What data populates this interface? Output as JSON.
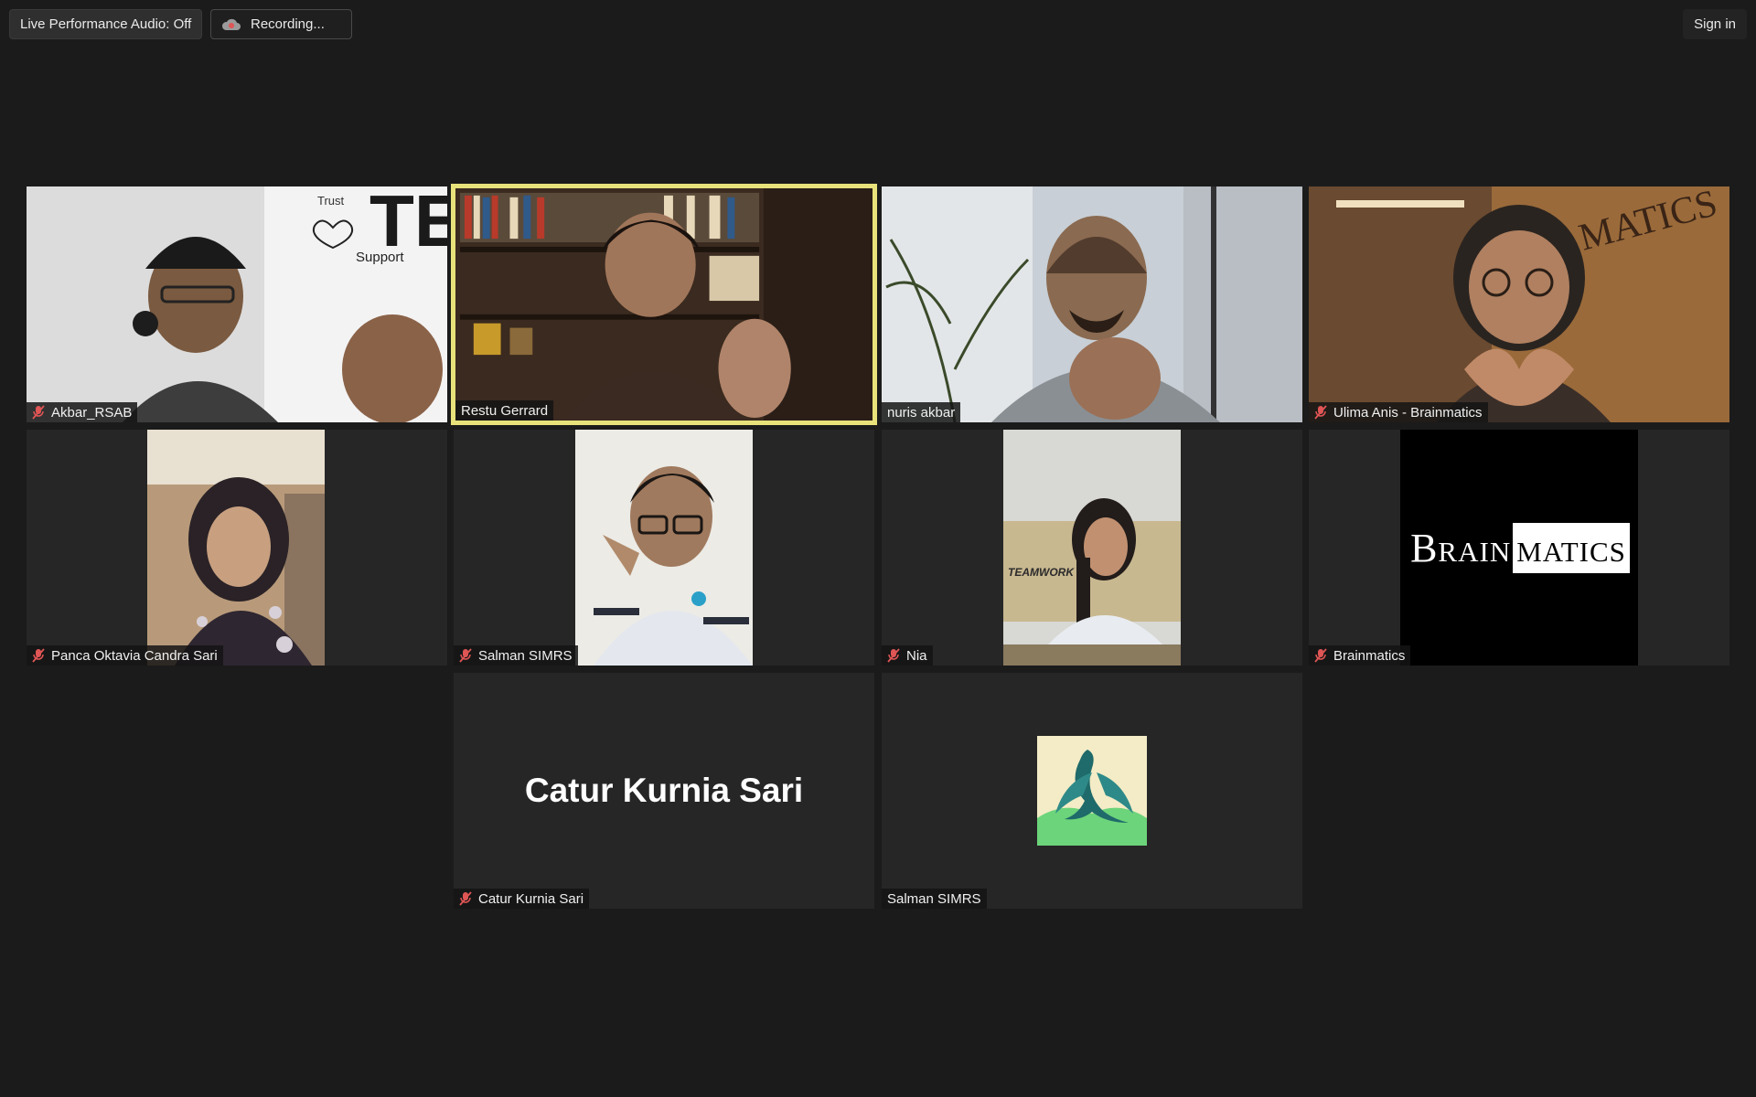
{
  "toolbar": {
    "live_audio_label": "Live Performance Audio: Off",
    "recording_label": "Recording...",
    "sign_in_label": "Sign in"
  },
  "colors": {
    "background": "#1b1b1b",
    "tile_background": "#262626",
    "active_speaker_border": "#e8e27a",
    "muted_icon": "#e05555"
  },
  "participants": [
    {
      "name": "Akbar_RSAB",
      "muted": true,
      "video": "camera"
    },
    {
      "name": "Restu Gerrard",
      "muted": false,
      "video": "camera",
      "active_speaker": true
    },
    {
      "name": "nuris akbar",
      "muted": false,
      "video": "camera"
    },
    {
      "name": "Ulima Anis - Brainmatics",
      "muted": true,
      "video": "camera"
    },
    {
      "name": "Panca Oktavia Candra Sari",
      "muted": true,
      "video": "camera"
    },
    {
      "name": "Salman SIMRS",
      "muted": true,
      "video": "camera"
    },
    {
      "name": "Nia",
      "muted": true,
      "video": "camera"
    },
    {
      "name": "Brainmatics",
      "muted": true,
      "video": "logo"
    },
    {
      "name": "Catur Kurnia Sari",
      "muted": true,
      "video": "off",
      "display_name": "Catur Kurnia Sari"
    },
    {
      "name": "Salman SIMRS",
      "muted": false,
      "video": "avatar"
    }
  ],
  "brainmatics_logo": {
    "part1": "Brain",
    "part2": "matics"
  }
}
